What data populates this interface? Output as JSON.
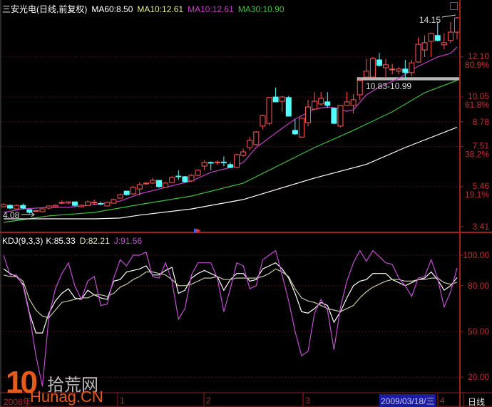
{
  "header": {
    "stock": "三安光电(日线,前复权)",
    "ma60": "MA60:8.50",
    "ma10a": "MA10:12.61",
    "ma10b": "MA10:12.61",
    "ma30": "MA30:10.90"
  },
  "kdj_header": {
    "name": "KDJ(9,3,3)",
    "k": "K:85.33",
    "d": "D:82.21",
    "j": "J:91.56"
  },
  "annotations": {
    "high": "14.15",
    "low": "4.08",
    "band": "10.83-10.99"
  },
  "bottom_axis": {
    "labels": [
      "2008年",
      "1",
      "2",
      "3",
      "4"
    ],
    "cursor_date": "2009/03/18/三",
    "period": "日线"
  },
  "watermark": {
    "num": "10",
    "cn": "拾荒网",
    "url": "Hunag.CN"
  },
  "colors": {
    "up": "#ff5a5a",
    "down": "#55ffff",
    "ma10": "#c040c0",
    "ma30": "#40c040",
    "ma60": "#ffffff",
    "axis": "#a02020",
    "k": "#ffffff",
    "d": "#c8c8a0",
    "j": "#c050d0"
  },
  "chart_data": [
    {
      "type": "candlestick",
      "title": "三安光电(日线,前复权)",
      "ylim": [
        3.41,
        14.3
      ],
      "y_ticks": [
        {
          "value": 12.1,
          "label": "12.10",
          "pct": "80.9%"
        },
        {
          "value": 10.05,
          "label": "10.05",
          "pct": "61.8%"
        },
        {
          "value": 8.78,
          "label": "8.78",
          "pct": ""
        },
        {
          "value": 7.51,
          "label": "7.51",
          "pct": "38.2%"
        },
        {
          "value": 5.46,
          "label": "5.46",
          "pct": "19.1%"
        },
        {
          "value": 3.41,
          "label": "3.41",
          "pct": ""
        }
      ],
      "band": {
        "from_index": 55,
        "low": 10.83,
        "high": 10.99
      },
      "ohlc": [
        [
          4.43,
          4.6,
          4.4,
          4.54
        ],
        [
          4.5,
          4.55,
          4.3,
          4.36
        ],
        [
          4.32,
          4.55,
          4.3,
          4.5
        ],
        [
          4.5,
          4.6,
          4.3,
          4.36
        ],
        [
          4.28,
          4.3,
          4.08,
          4.14
        ],
        [
          4.2,
          4.25,
          4.15,
          4.23
        ],
        [
          4.18,
          4.35,
          4.15,
          4.32
        ],
        [
          4.36,
          4.5,
          4.3,
          4.47
        ],
        [
          4.43,
          4.55,
          4.4,
          4.5
        ],
        [
          4.64,
          4.75,
          4.55,
          4.65
        ],
        [
          4.62,
          4.7,
          4.55,
          4.68
        ],
        [
          4.68,
          4.7,
          4.45,
          4.5
        ],
        [
          4.43,
          4.55,
          4.4,
          4.5
        ],
        [
          4.5,
          4.75,
          4.5,
          4.68
        ],
        [
          4.65,
          4.8,
          4.5,
          4.66
        ],
        [
          4.6,
          4.7,
          4.5,
          4.58
        ],
        [
          4.47,
          4.7,
          4.45,
          4.65
        ],
        [
          4.61,
          4.85,
          4.6,
          4.8
        ],
        [
          4.87,
          5.1,
          4.85,
          5.05
        ],
        [
          5.23,
          5.25,
          5.0,
          5.05
        ],
        [
          5.09,
          5.5,
          5.05,
          5.42
        ],
        [
          5.34,
          5.7,
          5.0,
          5.56
        ],
        [
          5.6,
          5.7,
          5.55,
          5.64
        ],
        [
          5.64,
          5.9,
          5.6,
          5.78
        ],
        [
          5.78,
          5.8,
          5.4,
          5.46
        ],
        [
          5.42,
          5.7,
          5.4,
          5.64
        ],
        [
          5.67,
          6.0,
          5.65,
          5.93
        ],
        [
          6.0,
          6.3,
          5.8,
          5.97
        ],
        [
          5.97,
          6.0,
          5.65,
          5.71
        ],
        [
          5.75,
          6.1,
          5.7,
          6.04
        ],
        [
          6.04,
          6.35,
          6.0,
          6.3
        ],
        [
          6.51,
          6.8,
          6.3,
          6.7
        ],
        [
          6.7,
          6.75,
          6.3,
          6.69
        ],
        [
          6.7,
          6.8,
          6.55,
          6.72
        ],
        [
          6.72,
          7.0,
          6.5,
          6.71
        ],
        [
          6.59,
          6.7,
          6.4,
          6.44
        ],
        [
          6.44,
          7.15,
          6.4,
          7.1
        ],
        [
          7.06,
          7.4,
          7.0,
          7.24
        ],
        [
          7.46,
          8.0,
          7.3,
          7.83
        ],
        [
          7.61,
          8.3,
          7.55,
          8.26
        ],
        [
          8.56,
          9.15,
          8.4,
          9.1
        ],
        [
          8.7,
          10.05,
          8.6,
          10.02
        ],
        [
          10.05,
          10.53,
          9.8,
          9.8
        ],
        [
          9.83,
          10.1,
          9.3,
          10.05
        ],
        [
          10.02,
          10.1,
          9.07,
          9.07
        ],
        [
          8.34,
          8.9,
          8.1,
          8.16
        ],
        [
          8.0,
          9.0,
          7.95,
          8.96
        ],
        [
          8.74,
          9.9,
          8.55,
          9.54
        ],
        [
          9.43,
          10.3,
          9.4,
          9.83
        ],
        [
          9.69,
          10.3,
          9.6,
          9.98
        ],
        [
          9.8,
          10.3,
          9.5,
          9.62
        ],
        [
          9.47,
          9.5,
          8.65,
          8.7
        ],
        [
          8.56,
          9.65,
          8.5,
          9.62
        ],
        [
          9.62,
          10.3,
          9.6,
          9.8
        ],
        [
          9.62,
          10.2,
          9.2,
          9.91
        ],
        [
          10.16,
          11.0,
          9.9,
          10.89
        ],
        [
          11.07,
          12.0,
          11.0,
          11.37
        ],
        [
          11.07,
          12.1,
          11.0,
          12.02
        ],
        [
          11.95,
          12.3,
          11.6,
          11.66
        ],
        [
          11.55,
          12.0,
          11.0,
          11.7
        ],
        [
          11.44,
          11.75,
          11.2,
          11.48
        ],
        [
          11.37,
          11.6,
          11.2,
          11.48
        ],
        [
          11.48,
          11.95,
          11.0,
          11.3
        ],
        [
          11.3,
          11.95,
          11.1,
          11.8
        ],
        [
          11.84,
          13.1,
          11.8,
          12.75
        ],
        [
          12.46,
          13.2,
          12.1,
          12.83
        ],
        [
          12.9,
          13.35,
          12.1,
          13.3
        ],
        [
          13.2,
          13.9,
          12.9,
          12.94
        ],
        [
          12.72,
          13.3,
          12.5,
          12.83
        ],
        [
          12.94,
          13.9,
          12.8,
          13.37
        ],
        [
          13.37,
          14.15,
          13.0,
          14.1
        ]
      ],
      "series": [
        {
          "name": "MA10",
          "points": [
            [
              0,
              4.14
            ],
            [
              3,
              4.32
            ],
            [
              7,
              4.4
            ],
            [
              10,
              4.4
            ],
            [
              14,
              4.54
            ],
            [
              18,
              4.72
            ],
            [
              21,
              5.09
            ],
            [
              25,
              5.42
            ],
            [
              29,
              5.75
            ],
            [
              32,
              6.19
            ],
            [
              35,
              6.44
            ],
            [
              37,
              6.7
            ],
            [
              39,
              7.46
            ],
            [
              43,
              8.45
            ],
            [
              45,
              8.92
            ],
            [
              48,
              9.43
            ],
            [
              50,
              9.54
            ],
            [
              51,
              9.5
            ],
            [
              53,
              9.32
            ],
            [
              54,
              9.4
            ],
            [
              56,
              10.16
            ],
            [
              58,
              10.56
            ],
            [
              61,
              11.0
            ],
            [
              64,
              11.62
            ],
            [
              67,
              12.1
            ],
            [
              69,
              12.28
            ],
            [
              70,
              12.61
            ]
          ]
        },
        {
          "name": "MA30",
          "points": [
            [
              0,
              3.63
            ],
            [
              7,
              3.96
            ],
            [
              14,
              4.14
            ],
            [
              21,
              4.54
            ],
            [
              29,
              4.98
            ],
            [
              37,
              5.64
            ],
            [
              48,
              7.46
            ],
            [
              54,
              8.34
            ],
            [
              60,
              9.29
            ],
            [
              65,
              10.27
            ],
            [
              70,
              10.9
            ]
          ]
        },
        {
          "name": "MA60",
          "points": [
            [
              0,
              3.81
            ],
            [
              14,
              3.81
            ],
            [
              18,
              3.85
            ],
            [
              21,
              4.0
            ],
            [
              29,
              4.32
            ],
            [
              37,
              4.8
            ],
            [
              48,
              5.9
            ],
            [
              56,
              6.6
            ],
            [
              62,
              7.46
            ],
            [
              70,
              8.5
            ]
          ]
        }
      ]
    },
    {
      "type": "line",
      "title": "KDJ(9,3,3)",
      "ylim": [
        12,
        105
      ],
      "y_ticks": [
        "100.00",
        "80.00",
        "50.00",
        "20.00"
      ],
      "series": [
        {
          "name": "K",
          "values": [
            91,
            88,
            86,
            81,
            62,
            49,
            49,
            62,
            70,
            75,
            78,
            72,
            71,
            77,
            74,
            72,
            71,
            83,
            84,
            89,
            90,
            91,
            93,
            87,
            87,
            90,
            92,
            75,
            77,
            85,
            88,
            90,
            88,
            86,
            77,
            84,
            88,
            88,
            83,
            84,
            91,
            93,
            95,
            91,
            85,
            75,
            63,
            62,
            65,
            69,
            67,
            56,
            63,
            72,
            80,
            83,
            84,
            88,
            88,
            88,
            84,
            82,
            80,
            82,
            84,
            85,
            89,
            84,
            77,
            80,
            85.33
          ]
        },
        {
          "name": "D",
          "values": [
            87,
            86,
            86,
            83,
            71,
            64,
            60,
            59,
            64,
            69,
            70,
            71,
            72,
            72,
            74,
            74,
            73,
            75,
            79,
            81,
            84,
            86,
            89,
            89,
            88,
            87,
            84,
            80,
            80,
            81,
            83,
            85,
            85,
            86,
            84,
            84,
            85,
            85,
            85,
            85,
            86,
            88,
            91,
            89,
            86,
            78,
            72,
            70,
            69,
            67,
            65,
            64,
            63,
            65,
            67,
            72,
            76,
            79,
            81,
            83,
            84,
            84,
            83,
            83,
            84,
            84,
            85,
            85,
            82,
            81,
            82.21
          ]
        },
        {
          "name": "J",
          "values": [
            100,
            87,
            87,
            80,
            61,
            34,
            14,
            60,
            78,
            88,
            95,
            80,
            71,
            83,
            86,
            67,
            68,
            85,
            97,
            93,
            100,
            100,
            102,
            86,
            85,
            95,
            83,
            58,
            65,
            87,
            95,
            95,
            95,
            85,
            63,
            78,
            95,
            93,
            78,
            80,
            97,
            100,
            103,
            87,
            70,
            50,
            34,
            37,
            62,
            71,
            64,
            38,
            66,
            83,
            95,
            103,
            96,
            103,
            99,
            95,
            94,
            85,
            80,
            73,
            85,
            86,
            97,
            85,
            66,
            76,
            91.56
          ]
        }
      ]
    }
  ]
}
